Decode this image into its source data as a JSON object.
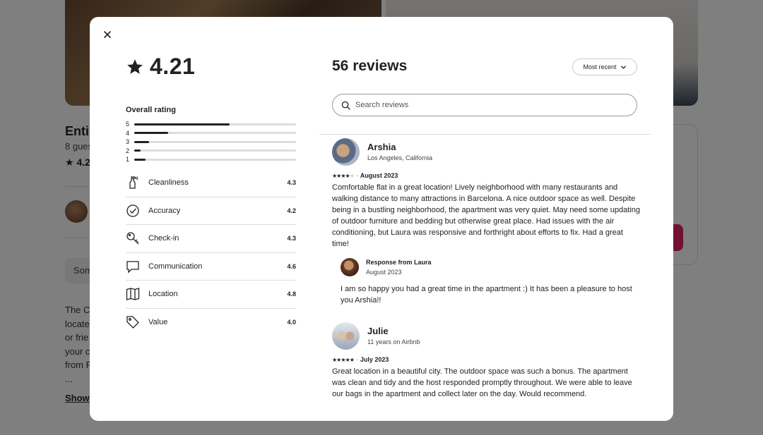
{
  "background": {
    "title": "Enti",
    "subtitle": "8 gues",
    "rating": "4.2",
    "pill": "Som",
    "desc_lines": [
      "The C",
      "locate",
      "or frie",
      "your c",
      "from F",
      "..."
    ],
    "show_more": "Show"
  },
  "modal": {
    "overall_score": "4.21",
    "overall_label": "Overall rating",
    "distribution": [
      {
        "stars": "5",
        "fraction": 0.59
      },
      {
        "stars": "4",
        "fraction": 0.21
      },
      {
        "stars": "3",
        "fraction": 0.09
      },
      {
        "stars": "2",
        "fraction": 0.04
      },
      {
        "stars": "1",
        "fraction": 0.07
      }
    ],
    "categories": [
      {
        "label": "Cleanliness",
        "value": "4.3",
        "icon": "spray-bottle-icon"
      },
      {
        "label": "Accuracy",
        "value": "4.2",
        "icon": "check-circle-icon"
      },
      {
        "label": "Check-in",
        "value": "4.3",
        "icon": "key-icon"
      },
      {
        "label": "Communication",
        "value": "4.6",
        "icon": "chat-bubble-icon"
      },
      {
        "label": "Location",
        "value": "4.8",
        "icon": "map-icon"
      },
      {
        "label": "Value",
        "value": "4.0",
        "icon": "tag-icon"
      }
    ],
    "reviews_title": "56 reviews",
    "sort_label": "Most recent",
    "search_placeholder": "Search reviews",
    "reviews": [
      {
        "name": "Arshia",
        "location": "Los Angeles, California",
        "rating": 4,
        "date": "August 2023",
        "text": "Comfortable flat in a great location! Lively neighborhood with many restaurants and walking distance to many attractions in Barcelona. A nice outdoor space as well. Despite being in a bustling neighborhood, the apartment was very quiet. May need some updating of outdoor furniture and bedding but otherwise great place. Had issues with the air conditioning, but Laura was responsive and forthright about efforts to fix. Had a great time!",
        "response": {
          "title": "Response from Laura",
          "date": "August 2023",
          "text": "I am so happy you had a great time in the apartment :) It has been a pleasure to host you Arshia!!"
        }
      },
      {
        "name": "Julie",
        "location": "11 years on Airbnb",
        "rating": 5,
        "date": "July 2023",
        "text": "Great location in a beautiful city. The outdoor space was such a bonus. The apartment was clean and tidy and the host responded promptly throughout. We were able to leave our bags in the apartment and collect later on the day. Would recommend."
      }
    ]
  }
}
